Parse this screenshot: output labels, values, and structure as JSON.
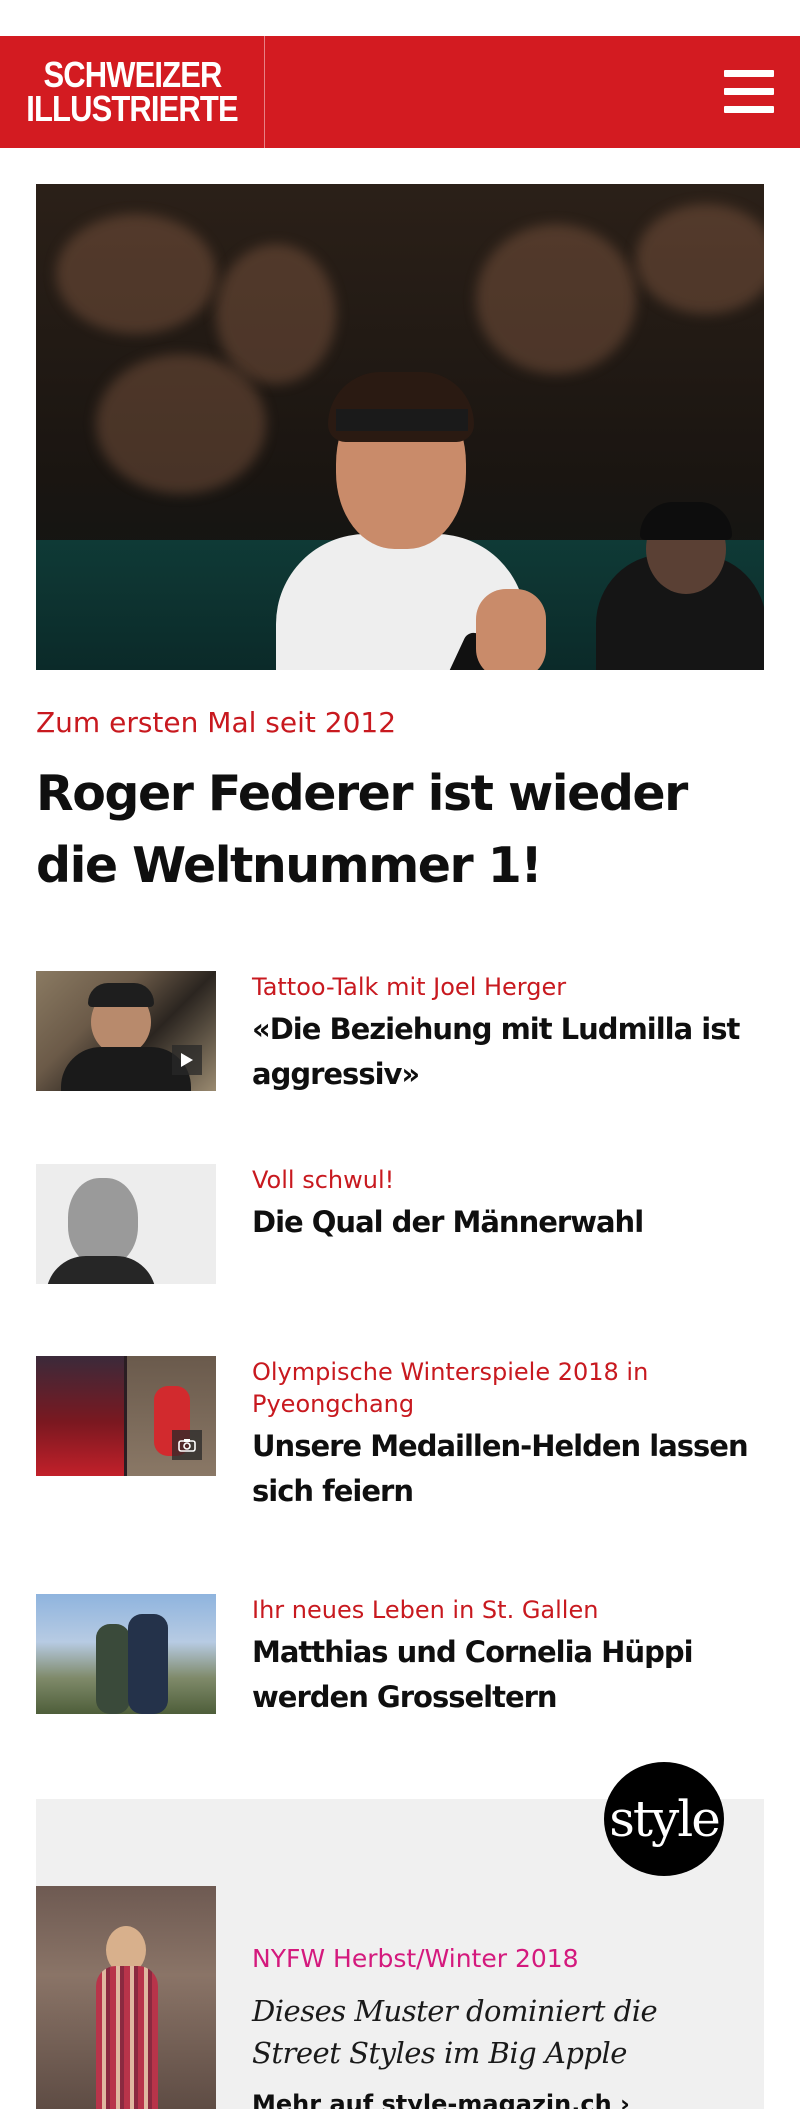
{
  "header": {
    "logo_line1": "SCHWEIZER",
    "logo_line2": "ILLUSTRIERTE",
    "brand_color": "#d31b21",
    "menu_icon": "hamburger-menu-icon"
  },
  "hero": {
    "kicker": "Zum ersten Mal seit 2012",
    "title": "Roger Federer ist wieder die Weltnummer 1!"
  },
  "teasers": [
    {
      "kicker": "Tattoo-Talk mit Joel Herger",
      "title": "«Die Beziehung mit Ludmilla ist aggressiv»",
      "badge_icon": "play-icon"
    },
    {
      "kicker": "Voll schwul!",
      "title": "Die Qual der Männerwahl",
      "badge_icon": ""
    },
    {
      "kicker": "Olympische Winterspiele 2018 in Pyeongchang",
      "title": "Unsere Medaillen-Helden lassen sich feiern",
      "badge_icon": "camera-icon"
    },
    {
      "kicker": "Ihr neues Leben in St. Gallen",
      "title": "Matthias und Cornelia Hüppi werden Grosseltern",
      "badge_icon": ""
    }
  ],
  "style_section": {
    "logo_text": "style",
    "kicker": "NYFW Herbst/Winter 2018",
    "title": "Dieses Muster dominiert die Street Styles im Big Apple",
    "more_link": "Mehr auf style-magazin.ch ›",
    "kicker_color": "#d4197d"
  },
  "colors": {
    "kicker_red": "#c8191f",
    "text_dark": "#0f0f0f"
  }
}
